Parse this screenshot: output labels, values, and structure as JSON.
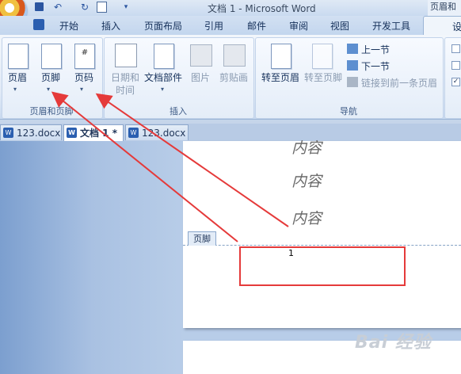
{
  "window": {
    "title": "文档 1 - Microsoft Word",
    "title_right": "页眉和"
  },
  "quick_access": {
    "undo_icon": "↶",
    "redo_icon": "↻"
  },
  "tabs": [
    "开始",
    "插入",
    "页面布局",
    "引用",
    "邮件",
    "审阅",
    "视图",
    "开发工具"
  ],
  "active_tab": "设",
  "ribbon": {
    "header_footer": {
      "header": "页眉",
      "footer": "页脚",
      "page_number": "页码",
      "group_label": "页眉和页脚"
    },
    "insert": {
      "date_time_1": "日期和",
      "date_time_2": "时间",
      "doc_parts": "文档部件",
      "picture": "图片",
      "clip_art": "剪贴画",
      "group_label": "插入"
    },
    "navigation": {
      "goto_header": "转至页眉",
      "goto_footer": "转至页脚",
      "prev_section": "上一节",
      "next_section": "下一节",
      "link_prev": "链接到前一条页眉",
      "group_label": "导航"
    }
  },
  "doc_tabs": [
    "123.docx",
    "文档 1 *",
    "123.docx"
  ],
  "document": {
    "content_lines": [
      "内容",
      "内容",
      "内容"
    ],
    "footer_tag": "页脚",
    "page_number": "1"
  },
  "watermark": "Bai 经验"
}
